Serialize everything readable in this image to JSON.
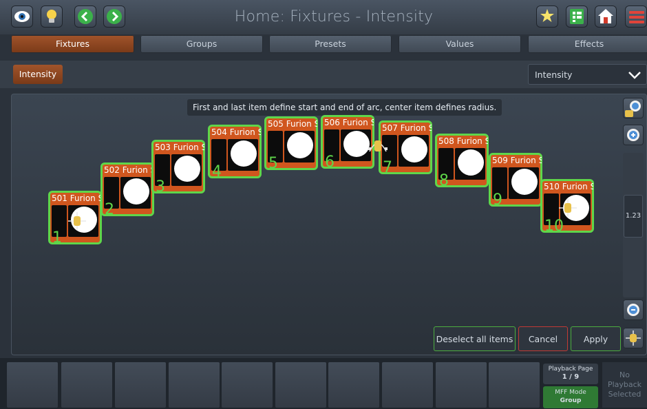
{
  "app": {
    "title": "Home: Fixtures - Intensity"
  },
  "toolbar": {
    "left_icons": [
      "eye-icon",
      "lightbulb-icon",
      "arrow-left-icon",
      "arrow-right-icon"
    ],
    "right_icons": [
      "magic-wand-icon",
      "grid-sheet-icon",
      "home-icon",
      "menu-icon"
    ]
  },
  "tabs": [
    {
      "label": "Fixtures",
      "active": true
    },
    {
      "label": "Groups",
      "active": false
    },
    {
      "label": "Presets",
      "active": false
    },
    {
      "label": "Values",
      "active": false
    },
    {
      "label": "Effects",
      "active": false
    }
  ],
  "subbar": {
    "mode_button": "Intensity",
    "dropdown_value": "Intensity"
  },
  "hint": "First and last item define start and end of arc, center item defines radius.",
  "fixtures": [
    {
      "name": "501 Furion S",
      "number": "1"
    },
    {
      "name": "502 Furion S",
      "number": "2"
    },
    {
      "name": "503 Furion S",
      "number": "3"
    },
    {
      "name": "504 Furion S",
      "number": "4"
    },
    {
      "name": "505 Furion S",
      "number": "5"
    },
    {
      "name": "506 Furion S",
      "number": "6"
    },
    {
      "name": "507 Furion S",
      "number": "7"
    },
    {
      "name": "508 Furion S",
      "number": "8"
    },
    {
      "name": "509 Furion S",
      "number": "9"
    },
    {
      "name": "510 Furion S",
      "number": "10"
    }
  ],
  "zoom": {
    "value": "1.23"
  },
  "actions": {
    "deselect": "Deselect all items",
    "cancel": "Cancel",
    "apply": "Apply"
  },
  "playback": {
    "page_label": "Playback Page",
    "page_value": "1 / 9",
    "mff_label": "MFF Mode",
    "mff_value": "Group",
    "none_line1": "No",
    "none_line2": "Playback",
    "none_line3": "Selected"
  },
  "colors": {
    "accent": "#d0561e",
    "selected_border": "#5fd64a",
    "active_tab": "#a1542b"
  }
}
